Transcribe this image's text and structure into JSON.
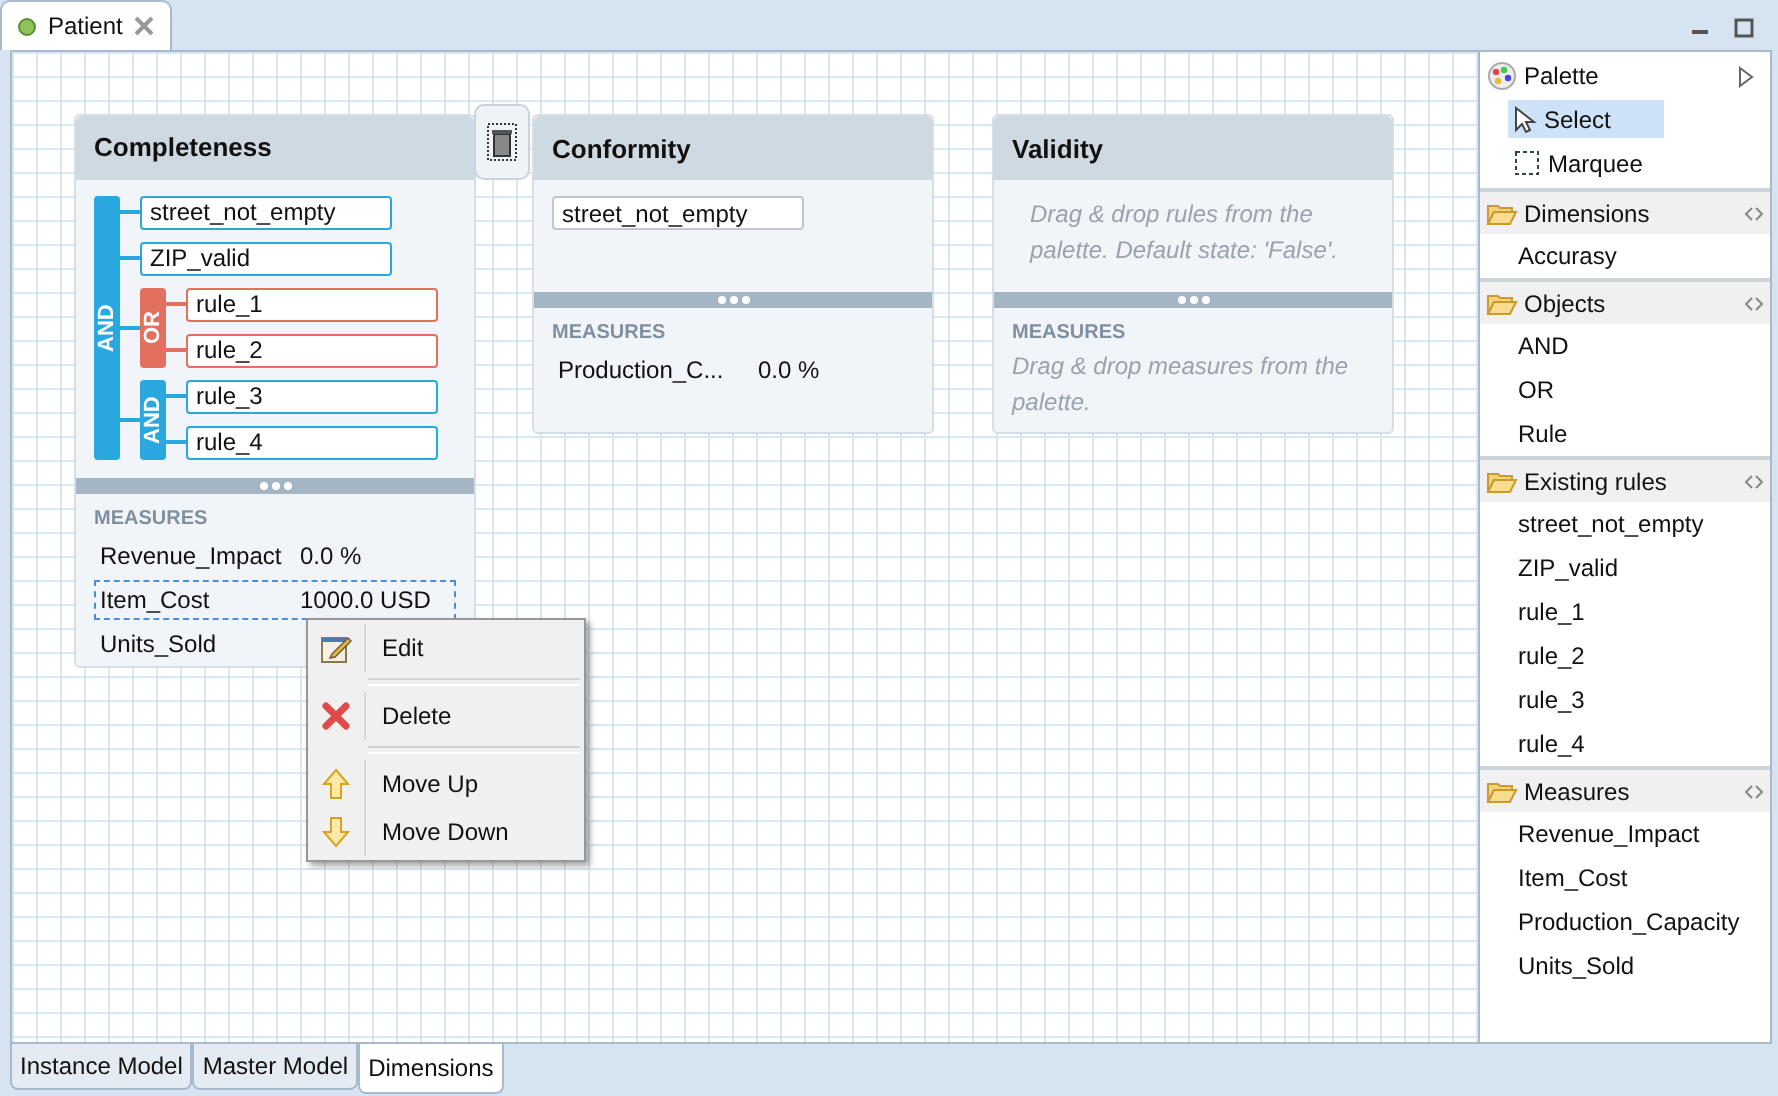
{
  "editor_tab": {
    "title": "Patient",
    "selected": true
  },
  "cards": [
    {
      "title": "Completeness",
      "rules": [
        {
          "kind": "group",
          "operator": "AND",
          "color": "#29a8e0",
          "children": [
            {
              "kind": "rule",
              "name": "street_not_empty"
            },
            {
              "kind": "rule",
              "name": "ZIP_valid"
            },
            {
              "kind": "group",
              "operator": "OR",
              "color": "#e3705f",
              "children": [
                {
                  "kind": "rule",
                  "name": "rule_1"
                },
                {
                  "kind": "rule",
                  "name": "rule_2"
                }
              ]
            },
            {
              "kind": "group",
              "operator": "AND",
              "color": "#29a8e0",
              "children": [
                {
                  "kind": "rule",
                  "name": "rule_3"
                },
                {
                  "kind": "rule",
                  "name": "rule_4"
                }
              ]
            }
          ]
        }
      ],
      "measures_label": "MEASURES",
      "measures": [
        {
          "name": "Revenue_Impact",
          "value": "0.0 %",
          "selected": false
        },
        {
          "name": "Item_Cost",
          "value": "1000.0 USD",
          "selected": true
        },
        {
          "name": "Units_Sold",
          "selected": false
        }
      ]
    },
    {
      "title": "Conformity",
      "rules": [
        {
          "kind": "rule",
          "name": "street_not_empty"
        }
      ],
      "measures_label": "MEASURES",
      "measures": [
        {
          "name": "Production_C...",
          "value": "0.0 %",
          "selected": false
        }
      ]
    },
    {
      "title": "Validity",
      "rules_hint": "Drag & drop rules from the palette. Default state: 'False'.",
      "measures_label": "MEASURES",
      "measures_hint": "Drag & drop measures from the palette."
    }
  ],
  "context_menu": {
    "sections": [
      [
        {
          "label": "Edit"
        }
      ],
      [
        {
          "label": "Delete"
        }
      ],
      [
        {
          "label": "Move Up"
        },
        {
          "label": "Move Down"
        }
      ]
    ]
  },
  "palette": {
    "title": "Palette",
    "tools": [
      {
        "label": "Select",
        "selected": true
      },
      {
        "label": "Marquee",
        "selected": false
      }
    ],
    "drawers": [
      {
        "title": "Dimensions",
        "items": [
          "Accurasy"
        ]
      },
      {
        "title": "Objects",
        "items": [
          "AND",
          "OR",
          "Rule"
        ]
      },
      {
        "title": "Existing rules",
        "items": [
          "street_not_empty",
          "ZIP_valid",
          "rule_1",
          "rule_2",
          "rule_3",
          "rule_4"
        ]
      },
      {
        "title": "Measures",
        "items": [
          "Revenue_Impact",
          "Item_Cost",
          "Production_Capacity",
          "Units_Sold"
        ]
      }
    ]
  },
  "bottom_tabs": [
    {
      "label": "Instance Model",
      "selected": false
    },
    {
      "label": "Master Model",
      "selected": false
    },
    {
      "label": "Dimensions",
      "selected": true
    }
  ]
}
